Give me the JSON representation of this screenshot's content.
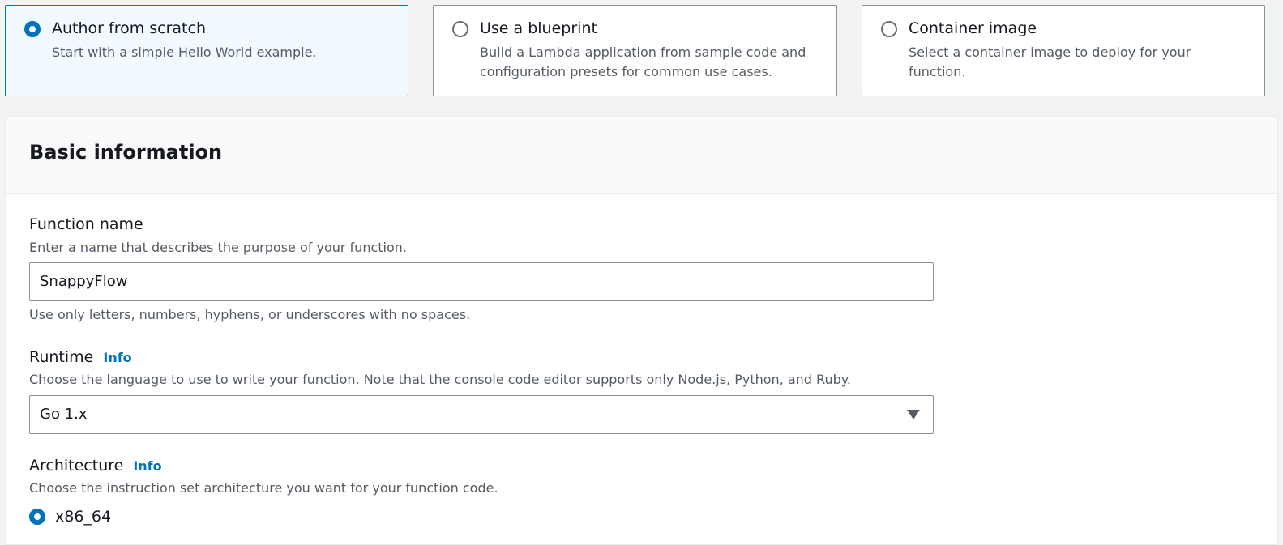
{
  "creation_options": [
    {
      "title": "Author from scratch",
      "description": "Start with a simple Hello World example.",
      "selected": true
    },
    {
      "title": "Use a blueprint",
      "description": "Build a Lambda application from sample code and configuration presets for common use cases.",
      "selected": false
    },
    {
      "title": "Container image",
      "description": "Select a container image to deploy for your function.",
      "selected": false
    }
  ],
  "basic_info": {
    "heading": "Basic information",
    "function_name": {
      "label": "Function name",
      "description": "Enter a name that describes the purpose of your function.",
      "value": "SnappyFlow",
      "constraint": "Use only letters, numbers, hyphens, or underscores with no spaces."
    },
    "runtime": {
      "label": "Runtime",
      "info": "Info",
      "description": "Choose the language to use to write your function. Note that the console code editor supports only Node.js, Python, and Ruby.",
      "selected": "Go 1.x"
    },
    "architecture": {
      "label": "Architecture",
      "info": "Info",
      "description": "Choose the instruction set architecture you want for your function code.",
      "options": [
        {
          "label": "x86_64",
          "selected": true
        }
      ]
    }
  },
  "colors": {
    "accent": "#0073bb",
    "selected_tile_bg": "#f1faff",
    "page_bg": "#f2f3f3"
  }
}
